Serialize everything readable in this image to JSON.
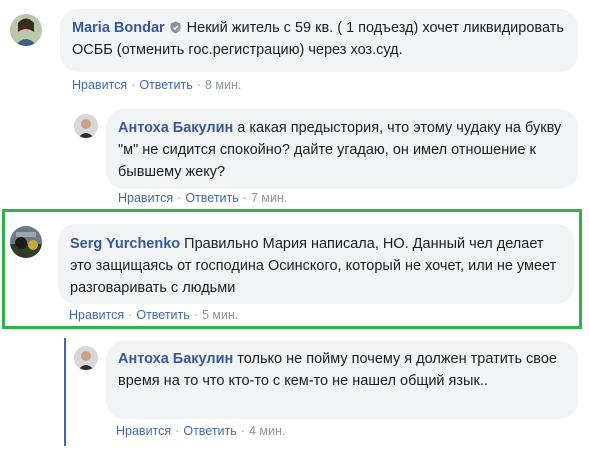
{
  "comments": [
    {
      "author": "Maria Bondar",
      "text": "Некий житель с 59 кв. ( 1 подъезд) хочет ликвидировать ОСББ (отменить гос.регистрацию) через хоз.суд.",
      "like": "Нравится",
      "reply": "Ответить",
      "time": "8 мин."
    },
    {
      "author": "Антоха Бакулин",
      "text": "а какая предыстория, что этому чудаку на букву \"м\" не сидится спокойно? дайте угадаю, он имел отношение к бывшему жеку?",
      "like": "Нравится",
      "reply": "Ответить",
      "time": "7 мин."
    },
    {
      "author": "Serg Yurchenko",
      "text": "Правильно Мария написала, НО. Данный чел делает это защищаясь от господина Осинского, который не хочет, или не умеет разговаривать с людьми",
      "like": "Нравится",
      "reply": "Ответить",
      "time": "5 мин."
    },
    {
      "author": "Антоха Бакулин",
      "text": "только не пойму почему я должен тратить свое время на то что кто-то с кем-то не нашел общий язык..",
      "like": "Нравится",
      "reply": "Ответить",
      "time": "4 мин."
    }
  ],
  "separator": "·",
  "colors": {
    "author": "#385898",
    "link": "#4267b2",
    "bubble": "#f2f3f5",
    "highlight": "#2db34a",
    "meta": "#90949c"
  },
  "icons": {
    "badge": "shield-badge-icon"
  }
}
